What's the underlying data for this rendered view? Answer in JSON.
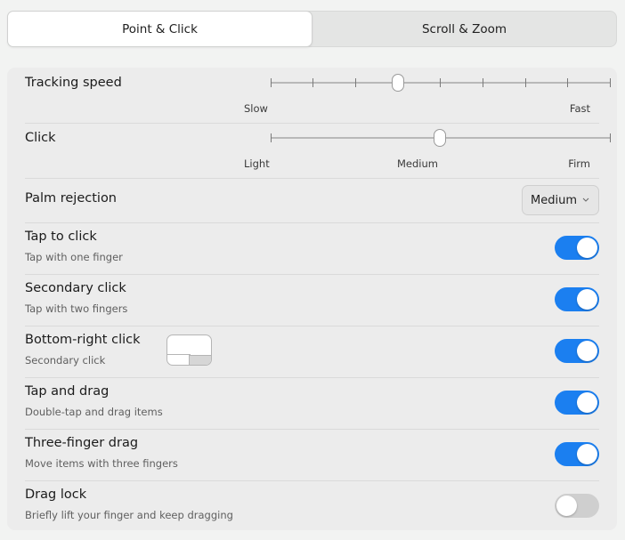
{
  "tabs": [
    {
      "label": "Point & Click",
      "active": true
    },
    {
      "label": "Scroll & Zoom",
      "active": false
    }
  ],
  "tracking_speed": {
    "label": "Tracking speed",
    "min_label": "Slow",
    "max_label": "Fast",
    "tick_count": 9,
    "value_index": 3
  },
  "click": {
    "label": "Click",
    "labels": [
      "Light",
      "Medium",
      "Firm"
    ],
    "value": "Medium"
  },
  "palm_rejection": {
    "label": "Palm rejection",
    "value": "Medium",
    "chevron_icon": "chevron-down-icon"
  },
  "toggles": [
    {
      "id": "tap-to-click",
      "label": "Tap to click",
      "sub": "Tap with one finger",
      "on": true
    },
    {
      "id": "secondary-click",
      "label": "Secondary click",
      "sub": "Tap with two fingers",
      "on": true
    },
    {
      "id": "bottom-right-click",
      "label": "Bottom-right click",
      "sub": "Secondary click",
      "on": true,
      "illustration": "trackpad-corner-icon"
    },
    {
      "id": "tap-and-drag",
      "label": "Tap and drag",
      "sub": "Double-tap and drag items",
      "on": true
    },
    {
      "id": "three-finger-drag",
      "label": "Three-finger drag",
      "sub": "Move items with three fingers",
      "on": true
    },
    {
      "id": "drag-lock",
      "label": "Drag lock",
      "sub": "Briefly lift your finger and keep dragging",
      "on": false
    }
  ],
  "colors": {
    "accent": "#1b7ff0",
    "toggle_off": "#cfcfcf",
    "card": "#ececec",
    "background": "#f2f3f2"
  }
}
